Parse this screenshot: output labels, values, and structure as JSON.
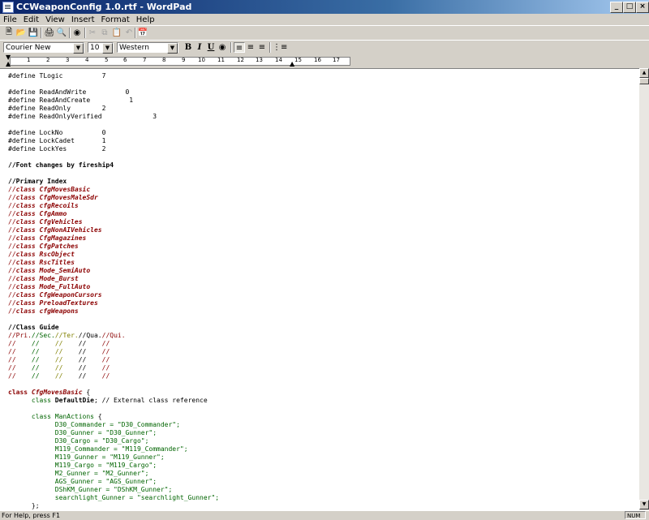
{
  "window": {
    "title": "CCWeaponConfig 1.0.rtf - WordPad",
    "minimize": "_",
    "maximize": "□",
    "close": "×"
  },
  "menu": [
    "File",
    "Edit",
    "View",
    "Insert",
    "Format",
    "Help"
  ],
  "format_bar": {
    "font": "Courier New",
    "size": "10",
    "script": "Western",
    "bold": "B",
    "italic": "I",
    "underline": "U"
  },
  "ruler": {
    "numbers": [
      "1",
      "2",
      "3",
      "4",
      "5",
      "6",
      "7",
      "8",
      "9",
      "10",
      "11",
      "12",
      "13",
      "14",
      "15",
      "16",
      "17"
    ]
  },
  "document": {
    "lines": [
      [
        {
          "t": "#define TLogic          7",
          "c": ""
        }
      ],
      [
        {
          "t": "",
          "c": ""
        }
      ],
      [
        {
          "t": "#define ReadAndWrite          0",
          "c": ""
        }
      ],
      [
        {
          "t": "#define ReadAndCreate          1",
          "c": ""
        }
      ],
      [
        {
          "t": "#define ReadOnly        2",
          "c": ""
        }
      ],
      [
        {
          "t": "#define ReadOnlyVerified             3",
          "c": ""
        }
      ],
      [
        {
          "t": "",
          "c": ""
        }
      ],
      [
        {
          "t": "#define LockNo          0",
          "c": ""
        }
      ],
      [
        {
          "t": "#define LockCadet       1",
          "c": ""
        }
      ],
      [
        {
          "t": "#define LockYes         2",
          "c": ""
        }
      ],
      [
        {
          "t": "",
          "c": ""
        }
      ],
      [
        {
          "t": "//Font changes by fireship4",
          "c": "b"
        }
      ],
      [
        {
          "t": "",
          "c": ""
        }
      ],
      [
        {
          "t": "//Primary Index",
          "c": "b"
        }
      ],
      [
        {
          "t": "//",
          "c": "cm"
        },
        {
          "t": "class CfgMovesBasic",
          "c": "cls"
        }
      ],
      [
        {
          "t": "//",
          "c": "cm"
        },
        {
          "t": "class CfgMovesMaleSdr",
          "c": "cls"
        }
      ],
      [
        {
          "t": "//",
          "c": "cm"
        },
        {
          "t": "class cfgRecoils",
          "c": "cls"
        }
      ],
      [
        {
          "t": "//",
          "c": "cm"
        },
        {
          "t": "class CfgAmmo",
          "c": "cls"
        }
      ],
      [
        {
          "t": "//",
          "c": "cm"
        },
        {
          "t": "class CfgVehicles",
          "c": "cls"
        }
      ],
      [
        {
          "t": "//",
          "c": "cm"
        },
        {
          "t": "class CfgNonAIVehicles",
          "c": "cls"
        }
      ],
      [
        {
          "t": "//",
          "c": "cm"
        },
        {
          "t": "class CfgMagazines",
          "c": "cls"
        }
      ],
      [
        {
          "t": "//",
          "c": "cm"
        },
        {
          "t": "class CfgPatches",
          "c": "cls"
        }
      ],
      [
        {
          "t": "//",
          "c": "cm"
        },
        {
          "t": "class RscObject",
          "c": "cls"
        }
      ],
      [
        {
          "t": "//",
          "c": "cm"
        },
        {
          "t": "class RscTitles",
          "c": "cls"
        }
      ],
      [
        {
          "t": "//",
          "c": "cm"
        },
        {
          "t": "class Mode_SemiAuto",
          "c": "cls"
        }
      ],
      [
        {
          "t": "//",
          "c": "cm"
        },
        {
          "t": "class Mode_Burst",
          "c": "cls"
        }
      ],
      [
        {
          "t": "//",
          "c": "cm"
        },
        {
          "t": "class Mode_FullAuto",
          "c": "cls"
        }
      ],
      [
        {
          "t": "//",
          "c": "cm"
        },
        {
          "t": "class CfgWeaponCursors",
          "c": "cls"
        }
      ],
      [
        {
          "t": "//",
          "c": "cm"
        },
        {
          "t": "class PreloadTextures",
          "c": "cls"
        }
      ],
      [
        {
          "t": "//",
          "c": "cm"
        },
        {
          "t": "class cfgWeapons",
          "c": "cls"
        }
      ],
      [
        {
          "t": "",
          "c": ""
        }
      ],
      [
        {
          "t": "//Class Guide",
          "c": "b"
        }
      ],
      [
        {
          "t": "//Pri.",
          "c": "cm"
        },
        {
          "t": "//Sec.",
          "c": "grn"
        },
        {
          "t": "//Ter.",
          "c": "olive"
        },
        {
          "t": "//Qua.",
          "c": ""
        },
        {
          "t": "//Qui.",
          "c": "cm"
        }
      ],
      [
        {
          "t": "//    ",
          "c": "cm"
        },
        {
          "t": "//    ",
          "c": "grn"
        },
        {
          "t": "//    ",
          "c": "olive"
        },
        {
          "t": "//    ",
          "c": ""
        },
        {
          "t": "//",
          "c": "cm"
        }
      ],
      [
        {
          "t": "//    ",
          "c": "cm"
        },
        {
          "t": "//    ",
          "c": "grn"
        },
        {
          "t": "//    ",
          "c": "olive"
        },
        {
          "t": "//    ",
          "c": ""
        },
        {
          "t": "//",
          "c": "cm"
        }
      ],
      [
        {
          "t": "//    ",
          "c": "cm"
        },
        {
          "t": "//    ",
          "c": "grn"
        },
        {
          "t": "//    ",
          "c": "olive"
        },
        {
          "t": "//    ",
          "c": ""
        },
        {
          "t": "//",
          "c": "cm"
        }
      ],
      [
        {
          "t": "//    ",
          "c": "cm"
        },
        {
          "t": "//    ",
          "c": "grn"
        },
        {
          "t": "//    ",
          "c": "olive"
        },
        {
          "t": "//    ",
          "c": ""
        },
        {
          "t": "//",
          "c": "cm"
        }
      ],
      [
        {
          "t": "//    ",
          "c": "cm"
        },
        {
          "t": "//    ",
          "c": "grn"
        },
        {
          "t": "//    ",
          "c": "olive"
        },
        {
          "t": "//    ",
          "c": ""
        },
        {
          "t": "//",
          "c": "cm"
        }
      ],
      [
        {
          "t": "",
          "c": ""
        }
      ],
      [
        {
          "t": "class ",
          "c": "kw"
        },
        {
          "t": "CfgMovesBasic",
          "c": "cls"
        },
        {
          "t": " {",
          "c": ""
        }
      ],
      [
        {
          "t": "      class ",
          "c": "grn"
        },
        {
          "t": "DefaultDie",
          "c": "b"
        },
        {
          "t": "; // External class reference",
          "c": ""
        }
      ],
      [
        {
          "t": "",
          "c": ""
        }
      ],
      [
        {
          "t": "      class ",
          "c": "grn"
        },
        {
          "t": "ManActions",
          "c": "grn"
        },
        {
          "t": " {",
          "c": ""
        }
      ],
      [
        {
          "t": "            D30_Commander = \"D30_Commander\";",
          "c": "grn"
        }
      ],
      [
        {
          "t": "            D30_Gunner = \"D30_Gunner\";",
          "c": "grn"
        }
      ],
      [
        {
          "t": "            D30_Cargo = \"D30_Cargo\";",
          "c": "grn"
        }
      ],
      [
        {
          "t": "            M119_Commander = \"M119_Commander\";",
          "c": "grn"
        }
      ],
      [
        {
          "t": "            M119_Gunner = \"M119_Gunner\";",
          "c": "grn"
        }
      ],
      [
        {
          "t": "            M119_Cargo = \"M119_Cargo\";",
          "c": "grn"
        }
      ],
      [
        {
          "t": "            M2_Gunner = \"M2_Gunner\";",
          "c": "grn"
        }
      ],
      [
        {
          "t": "            AGS_Gunner = \"AGS_Gunner\";",
          "c": "grn"
        }
      ],
      [
        {
          "t": "            DShKM_Gunner = \"DShKM_Gunner\";",
          "c": "grn"
        }
      ],
      [
        {
          "t": "            searchlight_Gunner = \"searchlight_Gunner\";",
          "c": "grn"
        }
      ],
      [
        {
          "t": "      };",
          "c": ""
        }
      ]
    ]
  },
  "status": {
    "message": "For Help, press F1",
    "num": "NUM"
  }
}
